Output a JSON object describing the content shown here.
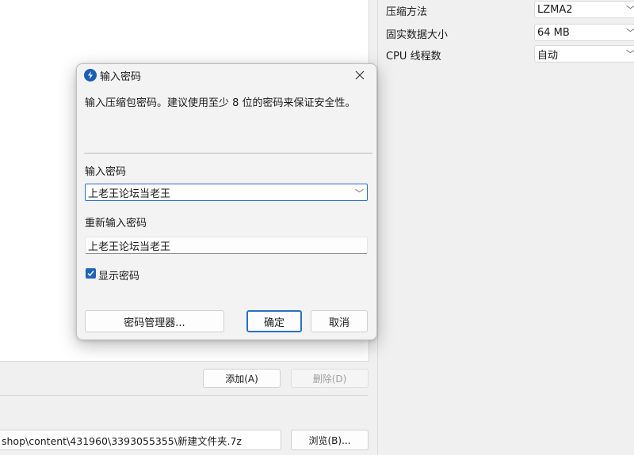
{
  "background": {
    "add_button": "添加(A)",
    "delete_button": "删除(D)",
    "path_value": "shop\\content\\431960\\3393055355\\新建文件夹.7z",
    "browse_button": "浏览(B)...",
    "properties": [
      {
        "label": "压缩方法",
        "value": "LZMA2"
      },
      {
        "label": "固实数据大小",
        "value": "64 MB"
      },
      {
        "label": "CPU 线程数",
        "value": "自动"
      }
    ]
  },
  "dialog": {
    "title": "输入密码",
    "description": "输入压缩包密码。建议使用至少 8 位的密码来保证安全性。",
    "password_label": "输入密码",
    "password_value": "上老王论坛当老王",
    "reenter_label": "重新输入密码",
    "reenter_value": "上老王论坛当老王",
    "show_password_label": "显示密码",
    "show_password_checked": true,
    "manager_button": "密码管理器...",
    "ok_button": "确定",
    "cancel_button": "取消"
  },
  "icons": {
    "app_icon": "app-icon",
    "close": "close-icon",
    "chevron": "chevron-down-icon",
    "check": "check-icon"
  },
  "colors": {
    "accent": "#2a6fc4",
    "checkbox": "#1f64b8"
  }
}
